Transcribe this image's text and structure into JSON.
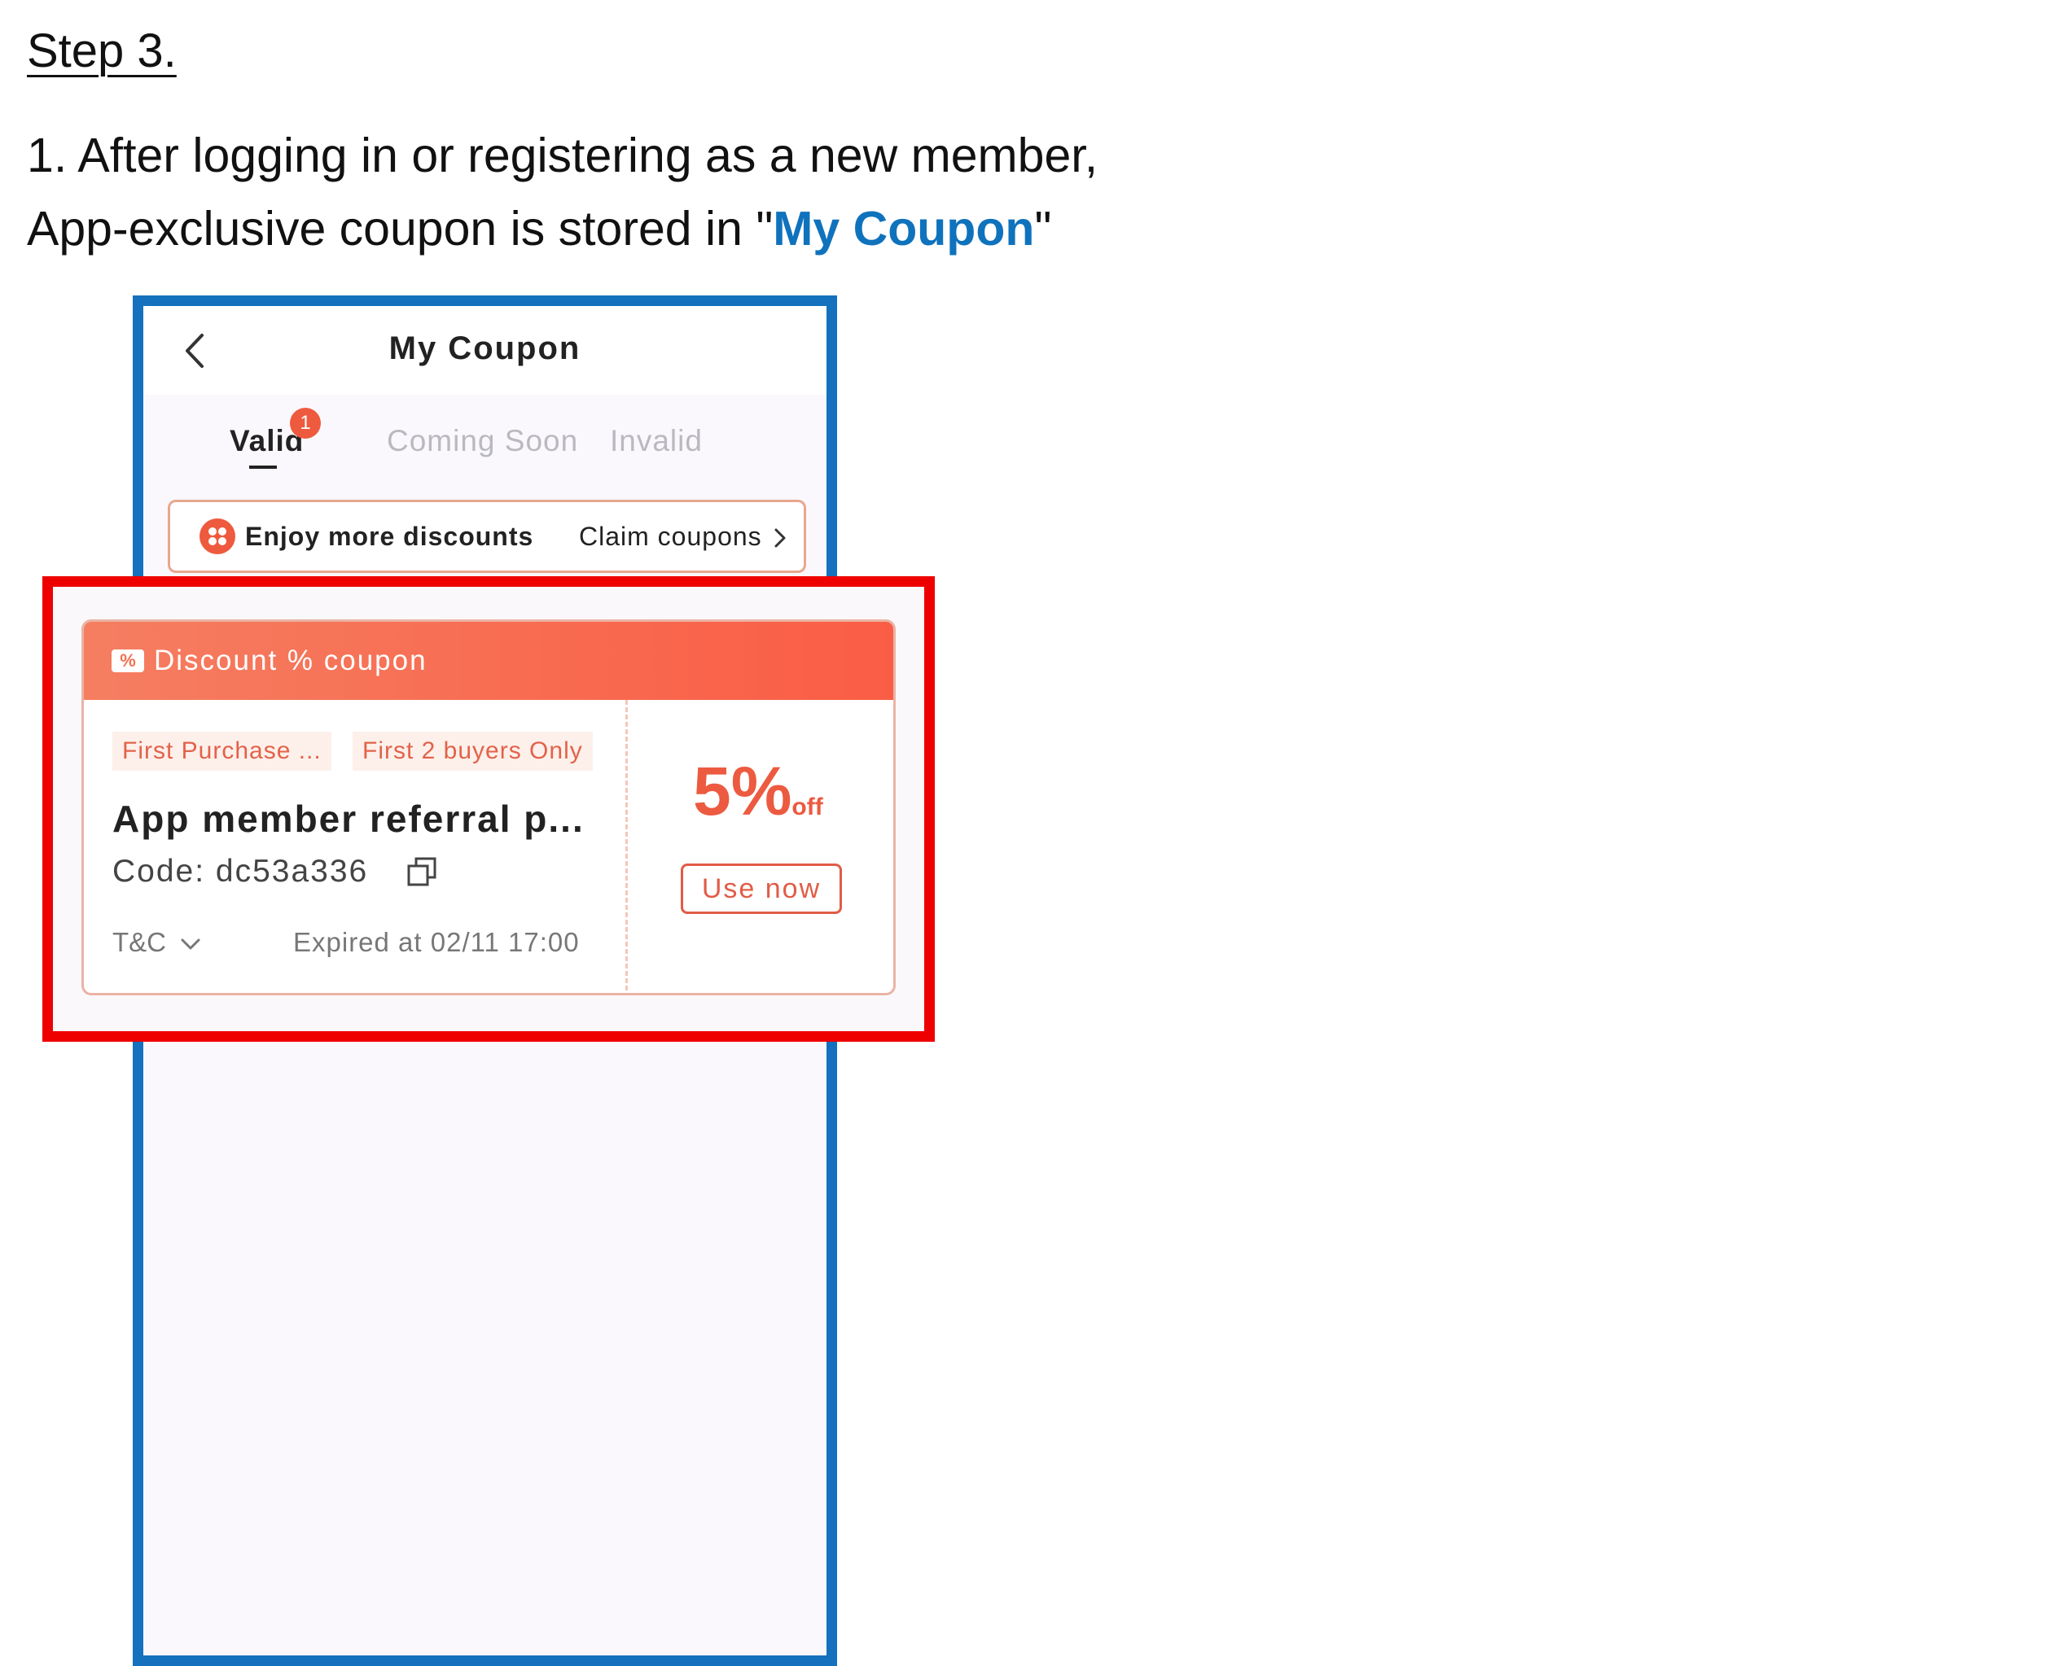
{
  "doc": {
    "step_title": "Step 3.",
    "line1": "1. After logging in or registering as a new member,",
    "line2_prefix": "App-exclusive coupon is stored in \"",
    "line2_highlight": "My Coupon",
    "line2_suffix": "\"",
    "highlight_color": "#0f72bc"
  },
  "app": {
    "header": {
      "title": "My Coupon",
      "back_icon": "chevron-left-icon"
    },
    "tabs": [
      {
        "label": "Valid",
        "active": true,
        "badge": "1"
      },
      {
        "label": "Coming Soon",
        "active": false
      },
      {
        "label": "Invalid",
        "active": false
      }
    ],
    "promo": {
      "icon": "grid-dots-icon",
      "label": "Enjoy more discounts",
      "link": "Claim coupons"
    },
    "coupon": {
      "type_label": "Discount % coupon",
      "type_icon": "ticket-percent-icon",
      "tags": [
        "First Purchase ...",
        "First 2 buyers Only"
      ],
      "name": "App member referral p...",
      "code": "Code: dc53a336",
      "tc_label": "T&C",
      "expiry": "Expired at 02/11 17:00",
      "discount_value": "5%",
      "discount_unit": "off",
      "cta": "Use now",
      "accent_color": "#ec5a40"
    }
  },
  "frame_colors": {
    "phone_border": "#1571bd",
    "highlight_border": "#ee0000"
  }
}
